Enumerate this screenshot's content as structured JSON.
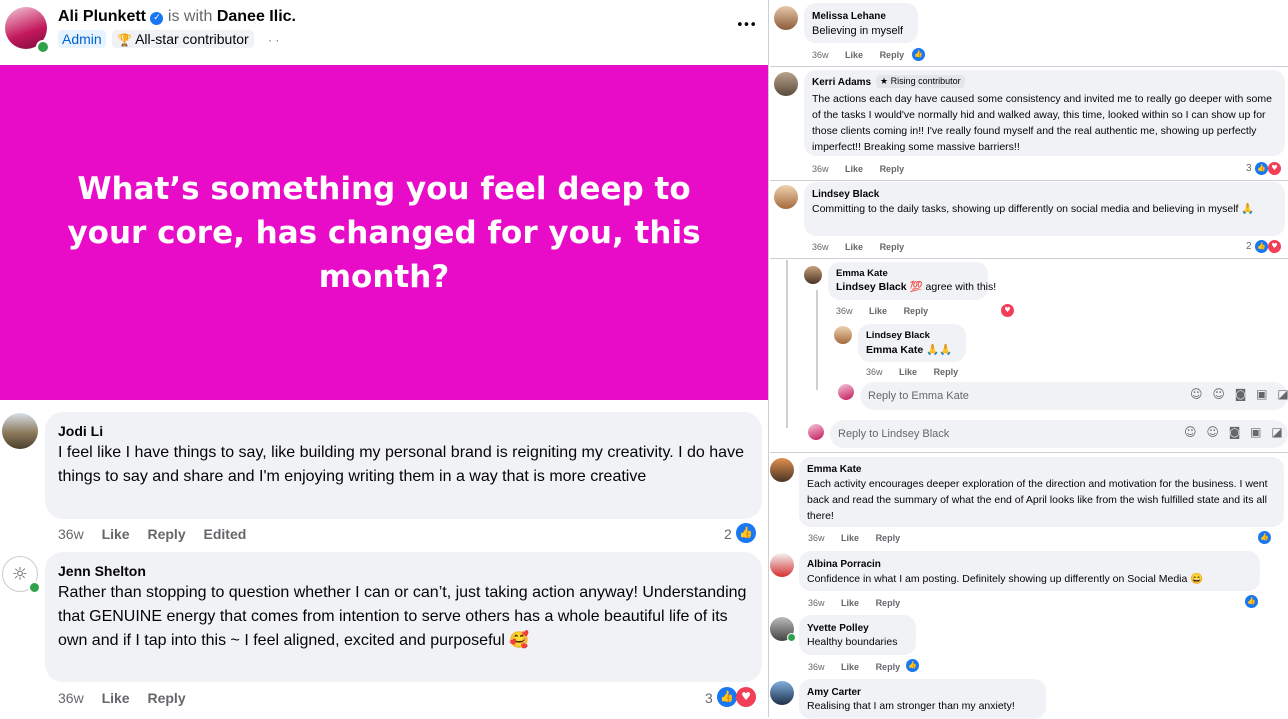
{
  "post": {
    "author": "Ali Plunkett",
    "with_prefix": "is with",
    "with_name": "Danee Ilic.",
    "admin_badge": "Admin",
    "contributor_badge": "All-star contributor",
    "dots": "· ·",
    "more": "•••",
    "banner_text": "What’s something you feel deep to your core, has changed for you, this month?",
    "banner_color": "#e80bc8"
  },
  "left_comments": [
    {
      "name": "Jodi Li",
      "text": "I feel like I have things to say, like building my personal brand is reigniting my creativity. I do have things to say and share and I'm enjoying writing them in a way that is more creative",
      "time": "36w",
      "like": "Like",
      "reply": "Reply",
      "edited": "Edited",
      "count": "2"
    },
    {
      "name": "Jenn Shelton",
      "text": "Rather than stopping to question whether I can or can’t, just taking action anyway! Understanding that GENUINE energy that comes from intention to serve others has a whole beautiful life of its own and if I tap into this ~ I feel aligned, excited and purposeful 🥰",
      "time": "36w",
      "like": "Like",
      "reply": "Reply",
      "count": "3"
    }
  ],
  "right_comments": {
    "c1": {
      "name": "Melissa Lehane",
      "text": "Believing in myself",
      "time": "36w",
      "like": "Like",
      "reply": "Reply"
    },
    "c2": {
      "name": "Kerri Adams",
      "badge": "Rising contributor",
      "text": "The actions each day have caused some consistency and invited me to really go deeper with some of the tasks I would've normally hid and walked away, this time, looked within so I can show up for those clients coming in!! I've really found myself and the real authentic me, showing up perfectly imperfect!! Breaking some massive barriers!!",
      "time": "36w",
      "like": "Like",
      "reply": "Reply",
      "count": "3"
    },
    "c3": {
      "name": "Lindsey Black",
      "text": "Committing to the daily tasks, showing up differently on social media and believing in myself 🙏",
      "time": "36w",
      "like": "Like",
      "reply": "Reply",
      "count": "2"
    },
    "r1": {
      "name": "Emma Kate",
      "tag": "Lindsey Black",
      "text": "💯 agree with this!",
      "time": "36w",
      "like": "Like",
      "reply": "Reply"
    },
    "r2": {
      "name": "Lindsey Black",
      "tag": "Emma Kate",
      "text": "🙏🙏",
      "time": "36w",
      "like": "Like",
      "reply": "Reply"
    },
    "reply_emma_placeholder": "Reply to Emma Kate",
    "reply_lindsey_placeholder": "Reply to Lindsey Black",
    "c4": {
      "name": "Emma Kate",
      "text": "Each activity encourages deeper exploration of the direction and motivation for the business. I went back and read the summary of what the end of April looks like from the wish fulfilled state and its all there!",
      "time": "36w",
      "like": "Like",
      "reply": "Reply"
    },
    "c5": {
      "name": "Albina Porracin",
      "text": "Confidence in what I am posting. Definitely showing up differently on Social Media 😄",
      "time": "36w",
      "like": "Like",
      "reply": "Reply"
    },
    "c6": {
      "name": "Yvette Polley",
      "text": "Healthy boundaries",
      "time": "36w",
      "like": "Like",
      "reply": "Reply"
    },
    "c7": {
      "name": "Amy Carter",
      "text": "Realising that I am stronger than my anxiety!"
    }
  },
  "colors": {
    "like_blue": "#1877f2",
    "love_red": "#f33e58",
    "online_green": "#31a24c",
    "admin_blue": "#0064d1"
  }
}
